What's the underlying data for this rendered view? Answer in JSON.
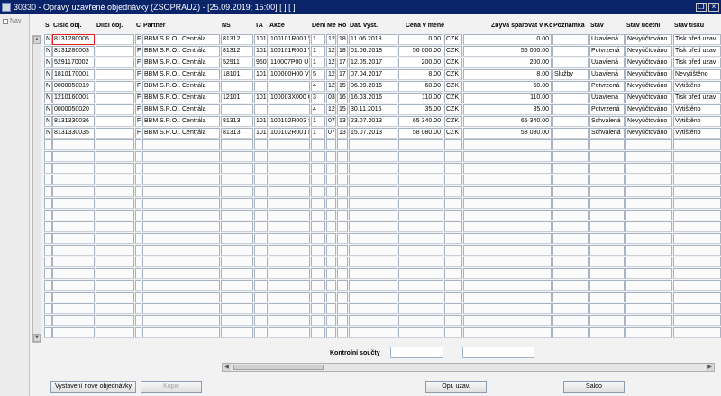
{
  "window": {
    "title": "30330 - Opravy uzavřené objednávky (ZSOPRAUZ) - [25.09.2019; 15:00]  [ ]  [ ]",
    "restore_glyph": "❐",
    "close_glyph": "×"
  },
  "nav": {
    "label": "Nav"
  },
  "columns": [
    "S",
    "Číslo obj.",
    "Dílčí obj.",
    "Č",
    "Partner",
    "NS",
    "TA",
    "Akce",
    "Dení",
    "Mě",
    "Ro",
    "Dat. vyst.",
    "Cena v měně",
    "",
    "Zbývá spárovat v Kč",
    "Poznámka",
    "Stav",
    "Stav účetní",
    "Stav tisku"
  ],
  "rows": [
    [
      "N",
      "8131280005",
      "",
      "F",
      "BBM S.R.O.. Centrála",
      "81312",
      "101",
      "100101R001 V",
      "1",
      "12",
      "18",
      "11.06.2018",
      "0.00",
      "CZK",
      "0.00",
      "",
      "Uzavřená",
      "Nevyúčtováno",
      "Tisk před uzav"
    ],
    [
      "N",
      "8131280003",
      "",
      "F",
      "BBM S.R.O.. Centrála",
      "81312",
      "101",
      "100101R001 V",
      "1",
      "12",
      "18",
      "01.06.2018",
      "56 000.00",
      "CZK",
      "56 000.00",
      "",
      "Potvrzená",
      "Nevyúčtováno",
      "Tisk před uzav"
    ],
    [
      "N",
      "5291170002",
      "",
      "F",
      "BBM S.R.O.. Centrála",
      "52911",
      "960",
      "110007P00 U",
      "1",
      "12",
      "17",
      "12.05.2017",
      "200.00",
      "CZK",
      "200.00",
      "",
      "Uzavřená",
      "Nevyúčtováno",
      "Tisk před uzav"
    ],
    [
      "N",
      "1810170001",
      "",
      "F",
      "BBM S.R.O.. Centrála",
      "18101",
      "101",
      "100000H00 V",
      "5",
      "12",
      "17",
      "07.04.2017",
      "8.00",
      "CZK",
      "8.00",
      "Služby",
      "Uzavřená",
      "Nevyúčtováno",
      "Nevytištěno"
    ],
    [
      "N",
      "0000050019",
      "",
      "F",
      "BBM S.R.O.. Centrála",
      "",
      "",
      "",
      "4",
      "12",
      "15",
      "06.09.2016",
      "60.00",
      "CZK",
      "60.00",
      "",
      "Potvrzená",
      "Nevyúčtováno",
      "Vytištěno"
    ],
    [
      "N",
      "1210160001",
      "",
      "F",
      "BBM S.R.O.. Centrála",
      "12101",
      "101",
      "100003X000 C",
      "3",
      "03",
      "16",
      "16.03.2016",
      "110.00",
      "CZK",
      "110.00",
      "",
      "Uzavřená",
      "Nevyúčtováno",
      "Tisk před uzav"
    ],
    [
      "N",
      "0000050020",
      "",
      "F",
      "BBM S.R.O.. Centrála",
      "",
      "",
      "",
      "4",
      "12",
      "15",
      "30.11.2015",
      "35.00",
      "CZK",
      "35.00",
      "",
      "Potvrzená",
      "Nevyúčtováno",
      "Vytištěno"
    ],
    [
      "N",
      "8131330036",
      "",
      "F",
      "BBM S.R.O.. Centrála",
      "81313",
      "101",
      "100102R003 S",
      "1",
      "07",
      "13",
      "23.07.2013",
      "65 340.00",
      "CZK",
      "65 340.00",
      "",
      "Schválená",
      "Nevyúčtováno",
      "Vytištěno"
    ],
    [
      "N",
      "8131330035",
      "",
      "F",
      "BBM S.R.O.. Centrála",
      "81313",
      "101",
      "100102R001 F",
      "1",
      "07",
      "13",
      "15.07.2013",
      "58 080.00",
      "CZK",
      "58 080.00",
      "",
      "Schválená",
      "Nevyúčtováno",
      "Vytištěno"
    ]
  ],
  "empty_row_count": 17,
  "totals": {
    "label": "Kontrolní součty",
    "cena": "",
    "zbyva": ""
  },
  "buttons": {
    "new_order": "Vystavení nové objednávky",
    "copy": "Kopie",
    "repair": "Opr. uzav.",
    "balance": "Saldo"
  },
  "colors": {
    "titlebar": "#0a246a",
    "selected_outline": "#e02020"
  }
}
